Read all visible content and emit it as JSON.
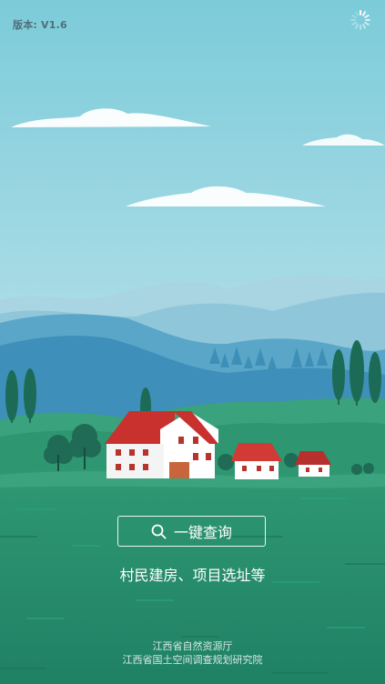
{
  "header": {
    "version_text": "版本: V1.6",
    "loading_icon": "spinner-icon"
  },
  "search": {
    "label": "一键查询",
    "icon": "search-icon"
  },
  "subtitle": "村民建房、项目选址等",
  "footer": {
    "line1": "江西省自然资源厅",
    "line2": "江西省国土空间调查规划研究院"
  },
  "colors": {
    "sky_top": "#79c9d8",
    "sky_bottom": "#cdebf0",
    "field": "#23896a",
    "roof": "#c8312e",
    "house_wall": "#ffffff"
  }
}
